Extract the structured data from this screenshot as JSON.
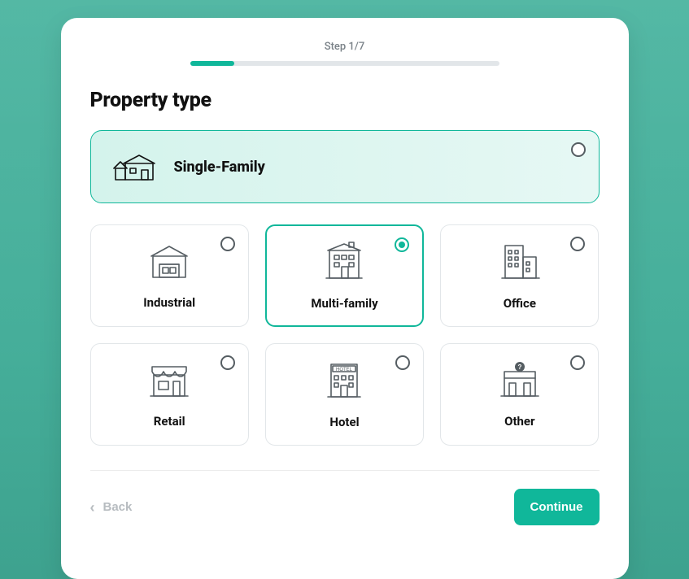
{
  "step": {
    "label": "Step 1/7",
    "progress_pct": 14.3
  },
  "title": "Property type",
  "featured": {
    "label": "Single-Family",
    "icon": "house-icon",
    "selected": false
  },
  "options": [
    {
      "id": "industrial",
      "label": "Industrial",
      "icon": "warehouse-icon",
      "selected": false
    },
    {
      "id": "multifamily",
      "label": "Multi-family",
      "icon": "apartment-icon",
      "selected": true
    },
    {
      "id": "office",
      "label": "Office",
      "icon": "office-icon",
      "selected": false
    },
    {
      "id": "retail",
      "label": "Retail",
      "icon": "storefront-icon",
      "selected": false
    },
    {
      "id": "hotel",
      "label": "Hotel",
      "icon": "hotel-icon",
      "selected": false
    },
    {
      "id": "other",
      "label": "Other",
      "icon": "other-icon",
      "selected": false
    }
  ],
  "footer": {
    "back": "Back",
    "continue": "Continue"
  },
  "colors": {
    "accent": "#10b79a",
    "border": "#e2e6e9",
    "text": "#111",
    "muted": "#7a8288"
  }
}
